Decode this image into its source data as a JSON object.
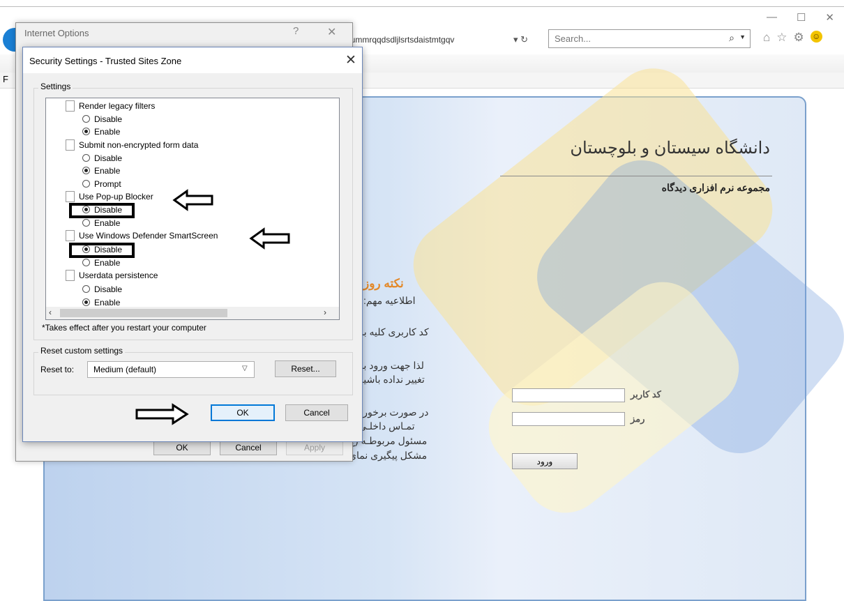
{
  "browser": {
    "address_text": "acummrqqdsdljlsrtsdaistmtgqv",
    "address_controls": "▾ ↻",
    "search_placeholder": "Search...",
    "window_controls": [
      "—",
      "☐",
      "✕"
    ],
    "tool_icons": [
      "home-icon",
      "favorites-star-icon",
      "gear-icon",
      "smiley-feedback-icon"
    ],
    "left_menu_letter": "F"
  },
  "page": {
    "university_title": "دانشگاه سیستان و بلوچستان",
    "subtitle": "مجموعه نرم افزاری دیدگاه",
    "tip_title": "نکته روز",
    "notice_heading": "اطلاعیه مهم:",
    "para1": "کد کاربری کلیه بر",
    "para2_line1": "لذا جهت ورود به",
    "para2_line2": "تغییر نداده باشید",
    "para3_line1": "در صورت برخورد",
    "para3_line2": "تمـاس داخلـی",
    "para3_line3": "مسئول مربوطـه (ج",
    "para3_line4": "مشکل پیگیری نمای",
    "username_label": "کد کاربر",
    "password_label": "رمز",
    "login_button": "ورود"
  },
  "internet_options": {
    "title": "Internet Options",
    "help": "?",
    "close": "✕",
    "ok": "OK",
    "cancel": "Cancel",
    "apply": "Apply"
  },
  "security_settings": {
    "title": "Security Settings - Trusted Sites Zone",
    "close": "✕",
    "settings_group": "Settings",
    "tree": [
      {
        "type": "setting",
        "label": "Render legacy filters"
      },
      {
        "type": "option",
        "label": "Disable",
        "checked": false
      },
      {
        "type": "option",
        "label": "Enable",
        "checked": true
      },
      {
        "type": "setting",
        "label": "Submit non-encrypted form data"
      },
      {
        "type": "option",
        "label": "Disable",
        "checked": false
      },
      {
        "type": "option",
        "label": "Enable",
        "checked": true
      },
      {
        "type": "option",
        "label": "Prompt",
        "checked": false
      },
      {
        "type": "setting",
        "label": "Use Pop-up Blocker"
      },
      {
        "type": "option",
        "label": "Disable",
        "checked": true,
        "highlight": true
      },
      {
        "type": "option",
        "label": "Enable",
        "checked": false
      },
      {
        "type": "setting",
        "label": "Use Windows Defender SmartScreen"
      },
      {
        "type": "option",
        "label": "Disable",
        "checked": true,
        "highlight": true
      },
      {
        "type": "option",
        "label": "Enable",
        "checked": false
      },
      {
        "type": "setting",
        "label": "Userdata persistence"
      },
      {
        "type": "option",
        "label": "Disable",
        "checked": false
      },
      {
        "type": "option",
        "label": "Enable",
        "checked": true
      }
    ],
    "restart_note": "*Takes effect after you restart your computer",
    "reset_group": "Reset custom settings",
    "reset_to_label": "Reset to:",
    "reset_to_value": "Medium (default)",
    "reset_button": "Reset...",
    "ok": "OK",
    "cancel": "Cancel"
  },
  "annotations": {
    "arrows": [
      "left-arrow",
      "left-arrow",
      "right-arrow"
    ],
    "highlight_color": "#000000"
  }
}
